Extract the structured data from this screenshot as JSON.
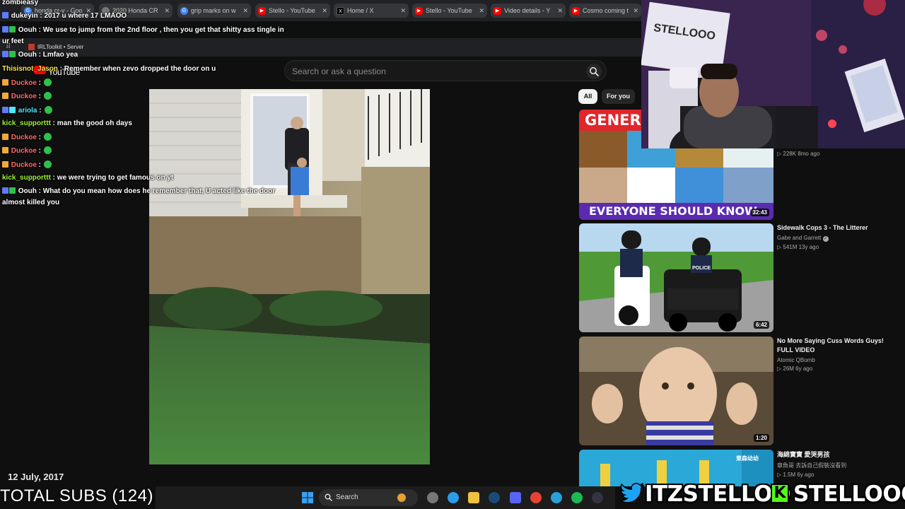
{
  "browser": {
    "tabs": [
      {
        "label": "honda cr-v - Goo",
        "icon": "google-icon",
        "color": "#4285f4"
      },
      {
        "label": "2020 Honda CR",
        "icon": "site-icon",
        "color": "#777777"
      },
      {
        "label": "grip marks on w",
        "icon": "google-icon",
        "color": "#4285f4"
      },
      {
        "label": "Stello - YouTube",
        "icon": "youtube-icon",
        "color": "#ff0000"
      },
      {
        "label": "Home / X",
        "icon": "x-icon",
        "color": "#000000"
      },
      {
        "label": "Stello - YouTube",
        "icon": "youtube-icon",
        "color": "#ff0000"
      },
      {
        "label": "Video details - Y",
        "icon": "youtube-icon",
        "color": "#ff0000"
      },
      {
        "label": "Cosmo coming t",
        "icon": "youtube-icon",
        "color": "#ff0000"
      }
    ],
    "bookmark": "IRLToolkit • Server"
  },
  "youtube": {
    "logo": "YouTube",
    "search_placeholder": "Search or ask a question",
    "chips": {
      "all": "All",
      "for_you": "For you"
    },
    "recommendations": [
      {
        "title": "",
        "channel": "",
        "meta": "228K   8mo ago",
        "duration": "32:43",
        "thumb_text_top": "GENERA",
        "thumb_text_bottom": "EVERYONE SHOULD KNOW"
      },
      {
        "title": "Sidewalk Cops 3 - The Litterer",
        "channel": "Gabe and Garrett",
        "verified": true,
        "meta": "541M   13y ago",
        "duration": "6:42",
        "thumb_text": "POLICE"
      },
      {
        "title": "No More Saying Cuss Words Guys! FULL VIDEO",
        "channel": "Atomic QBomb",
        "meta": "26M   6y ago",
        "duration": "1:20"
      },
      {
        "title": "海綿寶寶 愛哭男孩",
        "channel": "章魚哥 去訴自己假裝沒看到",
        "meta": "1.5M   6y ago",
        "thumb_text": "東森幼幼"
      }
    ]
  },
  "chat": {
    "messages": [
      {
        "user": "zombieasy",
        "text": "",
        "color": "#ffffff"
      },
      {
        "user": "dukeyin",
        "text": " :   2017    u where 17 LMAOO",
        "color": "#ffffff"
      },
      {
        "user": "Oouh",
        "text": " : We use to jump from the 2nd floor , then you get that shitty ass tingle in",
        "cont": "ur feet",
        "color": "#ffffff"
      },
      {
        "user": "Oouh",
        "text": " : Lmfao yea",
        "color": "#ffffff"
      },
      {
        "user": "Thisisnot_Jason",
        "text": " : Remember when zevo dropped the door on u",
        "color": "#f9e44c"
      },
      {
        "user": "Duckoe",
        "text": " :",
        "color": "#ff6b6b"
      },
      {
        "user": "Duckoe",
        "text": " :",
        "color": "#ff6b6b"
      },
      {
        "user": "ariola",
        "text": " :",
        "color": "#4ee8ff"
      },
      {
        "user": "kick_supporttt",
        "text": " : man the good oh days",
        "color": "#9cf233"
      },
      {
        "user": "Duckoe",
        "text": " :",
        "color": "#ff6b6b"
      },
      {
        "user": "Duckoe",
        "text": " :",
        "color": "#ff6b6b"
      },
      {
        "user": "Duckoe",
        "text": " :",
        "color": "#ff6b6b"
      },
      {
        "user": "kick_supporttt",
        "text": " : we were trying to get famous on yt",
        "color": "#9cf233"
      },
      {
        "user": "Oouh",
        "text": " : What do you mean how does he remember that, U acted like the door",
        "cont": "almost killed you",
        "color": "#ffffff"
      }
    ]
  },
  "overlay": {
    "date": "12 July, 2017",
    "total_subs": "TOTAL SUBS (124)",
    "twitter_handle": "ITZSTELLOO",
    "kick_handle": "STELLOOO",
    "webcam_sign": "STELLOOO"
  },
  "taskbar": {
    "search_label": "Search"
  }
}
